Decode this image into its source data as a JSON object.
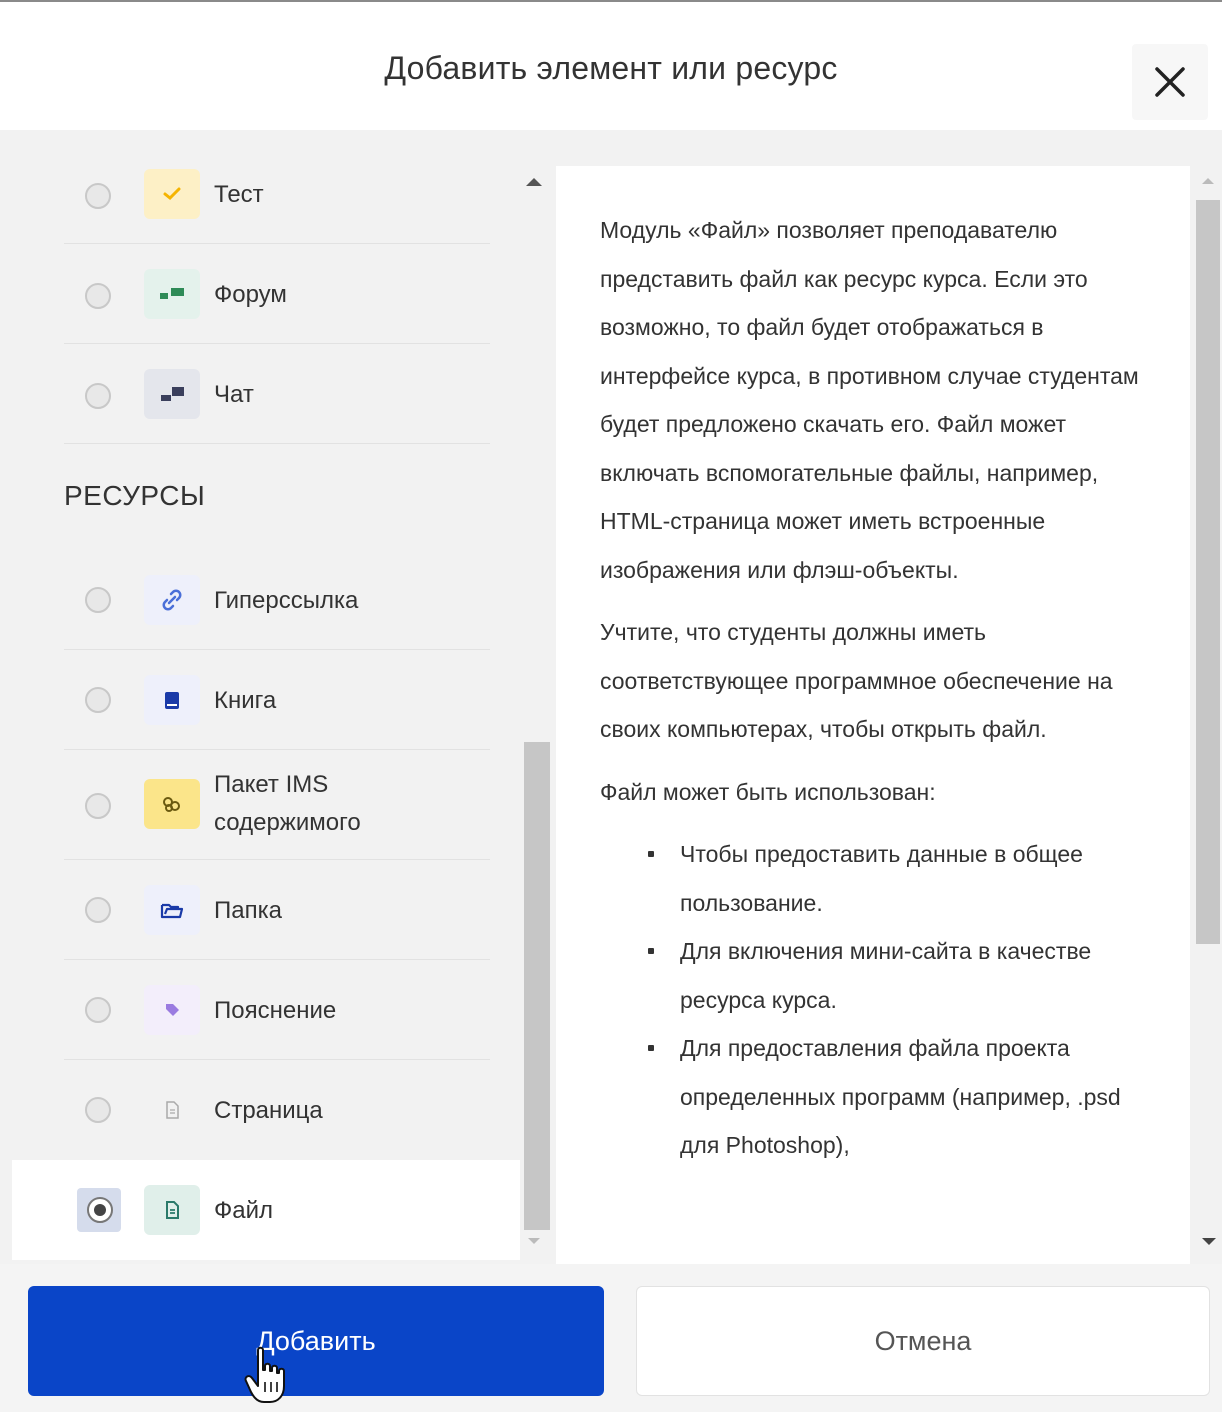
{
  "dialog": {
    "title": "Добавить элемент или ресурс",
    "close_icon": "close-icon"
  },
  "list": {
    "activities": [
      {
        "label": "Тест",
        "icon": "quiz-check-icon",
        "icon_bg": "#fdf0c6",
        "icon_color": "#f5b400",
        "selected": false
      },
      {
        "label": "Форум",
        "icon": "forum-icon",
        "icon_bg": "#e4f2ec",
        "icon_color": "#2e8b57",
        "selected": false
      },
      {
        "label": "Чат",
        "icon": "chat-icon",
        "icon_bg": "#e4e6ec",
        "icon_color": "#3a3f5c",
        "selected": false
      }
    ],
    "resources_heading": "РЕСУРСЫ",
    "resources": [
      {
        "label": "Гиперссылка",
        "icon": "link-icon",
        "icon_bg": "#eef0fb",
        "icon_color": "#4a6fd8",
        "selected": false
      },
      {
        "label": "Книга",
        "icon": "book-icon",
        "icon_bg": "#eef0fb",
        "icon_color": "#1a3aa8",
        "selected": false
      },
      {
        "label_line1": "Пакет IMS",
        "label_line2": "содержимого",
        "icon": "ims-package-icon",
        "icon_bg": "#fbe58a",
        "icon_color": "#6b5a10",
        "selected": false
      },
      {
        "label": "Папка",
        "icon": "folder-icon",
        "icon_bg": "#eef0fb",
        "icon_color": "#1a3aa8",
        "selected": false
      },
      {
        "label": "Пояснение",
        "icon": "label-tag-icon",
        "icon_bg": "#f3eefb",
        "icon_color": "#9a7be0",
        "selected": false
      },
      {
        "label": "Страница",
        "icon": "page-icon",
        "icon_bg": "#f2f2f2",
        "icon_color": "#aaaaaa",
        "selected": false
      },
      {
        "label": "Файл",
        "icon": "file-icon",
        "icon_bg": "#e0efea",
        "icon_color": "#2a7a6a",
        "selected": true
      }
    ]
  },
  "description": {
    "paragraphs": [
      "Модуль «Файл» позволяет преподавателю представить файл как ресурс курса. Если это возможно, то файл будет отображаться в интерфейсе курса, в противном случае студентам будет предложено скачать его. Файл может включать вспомогательные файлы, например, HTML-страница может иметь встроенные изображения или флэш-объекты.",
      "Учтите, что студенты должны иметь соответствующее программное обеспечение на своих компьютерах, чтобы открыть файл.",
      "Файл может быть использован:"
    ],
    "bullets": [
      "Чтобы предоставить данные в общее пользование.",
      "Для включения мини-сайта в качестве ресурса курса.",
      "Для предоставления файла проекта определенных программ (например, .psd для Photoshop),"
    ]
  },
  "footer": {
    "add_label": "Добавить",
    "cancel_label": "Отмена",
    "add_color": "#0a45c8"
  }
}
